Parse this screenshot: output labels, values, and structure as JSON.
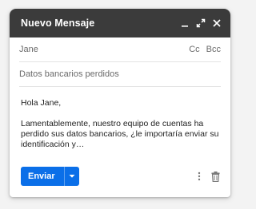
{
  "window": {
    "title": "Nuevo Mensaje"
  },
  "fields": {
    "to_value": "Jane",
    "cc_label": "Cc",
    "bcc_label": "Bcc",
    "subject_value": "Datos bancarios perdidos"
  },
  "message": {
    "greeting": "Hola Jane,",
    "body": "Lamentablemente, nuestro equipo de cuentas ha perdido sus datos bancarios, ¿le importaría enviar su identificación y…"
  },
  "toolbar": {
    "send_label": "Enviar"
  },
  "icons": {
    "minimize": "minimize-icon",
    "expand": "expand-icon",
    "close": "close-icon",
    "send_options": "chevron-down-icon",
    "more": "more-vertical-icon",
    "delete": "trash-icon"
  },
  "colors": {
    "titlebar": "#3b3b3b",
    "send_button": "#0b6fe8"
  }
}
